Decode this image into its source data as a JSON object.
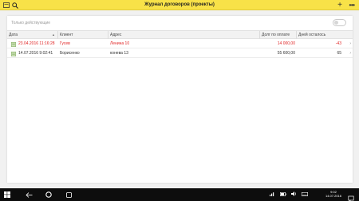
{
  "header": {
    "title": "Журнал договоров (проекты)",
    "accent_color": "#f8e248",
    "icons": [
      "menu-icon",
      "search-icon",
      "plus-icon",
      "more-icon"
    ],
    "add_symbol": "+",
    "more_symbol": "•••"
  },
  "filter": {
    "label": "Только действующие",
    "toggle_on": false
  },
  "table": {
    "columns": [
      "Дата",
      "Клиент",
      "Адрес",
      "Долг по оплате",
      "Дней осталось"
    ],
    "sort_indicator": "▲",
    "rows": [
      {
        "date": "23.04.2016 11:16:28",
        "client": "Гусев",
        "address": "Ленина 10",
        "debt": "14 000,00",
        "days_left": "-43",
        "status_color": "#e02323"
      },
      {
        "date": "14.07.2016 9:02:41",
        "client": "Борисенко",
        "address": "конева 13",
        "debt": "55 600,00",
        "days_left": "65",
        "status_color": "#333333"
      }
    ]
  },
  "taskbar": {
    "time": "9:02",
    "date": "14.07.2016",
    "icons": [
      "windows-icon",
      "back-icon",
      "home-icon",
      "task-view-icon",
      "network-icon",
      "battery-icon",
      "volume-icon",
      "keyboard-icon",
      "notification-icon"
    ]
  }
}
